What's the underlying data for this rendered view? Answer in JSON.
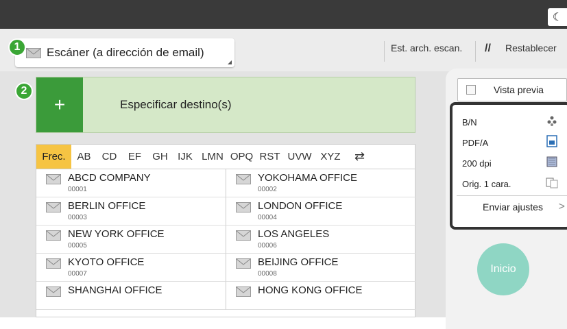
{
  "mode": {
    "label": "Escáner (a dirección de email)"
  },
  "badges": [
    "1",
    "2"
  ],
  "toolbar": {
    "store_label": "Est. arch. escan.",
    "reset_label": "Restablecer"
  },
  "destination": {
    "plus": "+",
    "label": "Especificar destino(s)"
  },
  "tabs": [
    "Frec.",
    "AB",
    "CD",
    "EF",
    "GH",
    "IJK",
    "LMN",
    "OPQ",
    "RST",
    "UVW",
    "XYZ"
  ],
  "swap_icon": "⇄",
  "entries": [
    {
      "name": "ABCD COMPANY",
      "num": "00001"
    },
    {
      "name": "YOKOHAMA OFFICE",
      "num": "00002"
    },
    {
      "name": "BERLIN OFFICE",
      "num": "00003"
    },
    {
      "name": "LONDON OFFICE",
      "num": "00004"
    },
    {
      "name": "NEW YORK OFFICE",
      "num": "00005"
    },
    {
      "name": "LOS ANGELES",
      "num": "00006"
    },
    {
      "name": "KYOTO OFFICE",
      "num": "00007"
    },
    {
      "name": "BEIJING OFFICE",
      "num": "00008"
    },
    {
      "name": "SHANGHAI  OFFICE",
      "num": ""
    },
    {
      "name": "HONG KONG OFFICE",
      "num": ""
    }
  ],
  "preview": {
    "label": "Vista previa"
  },
  "settings": [
    {
      "label": "B/N",
      "icon": "color-mode-icon"
    },
    {
      "label": "PDF/A",
      "icon": "file-type-icon"
    },
    {
      "label": "200 dpi",
      "icon": "resolution-icon"
    },
    {
      "label": "Orig. 1 cara.",
      "icon": "original-sides-icon"
    }
  ],
  "send_settings": {
    "label": "Enviar ajustes",
    "chevron": ">"
  },
  "start": {
    "label": "Inicio"
  },
  "colors": {
    "accent_green": "#3b9b3a",
    "dest_bg": "#d5e8c8",
    "tab_active": "#f6c443",
    "start_btn": "#8fd6c4",
    "topbar": "#3a3a3a"
  }
}
